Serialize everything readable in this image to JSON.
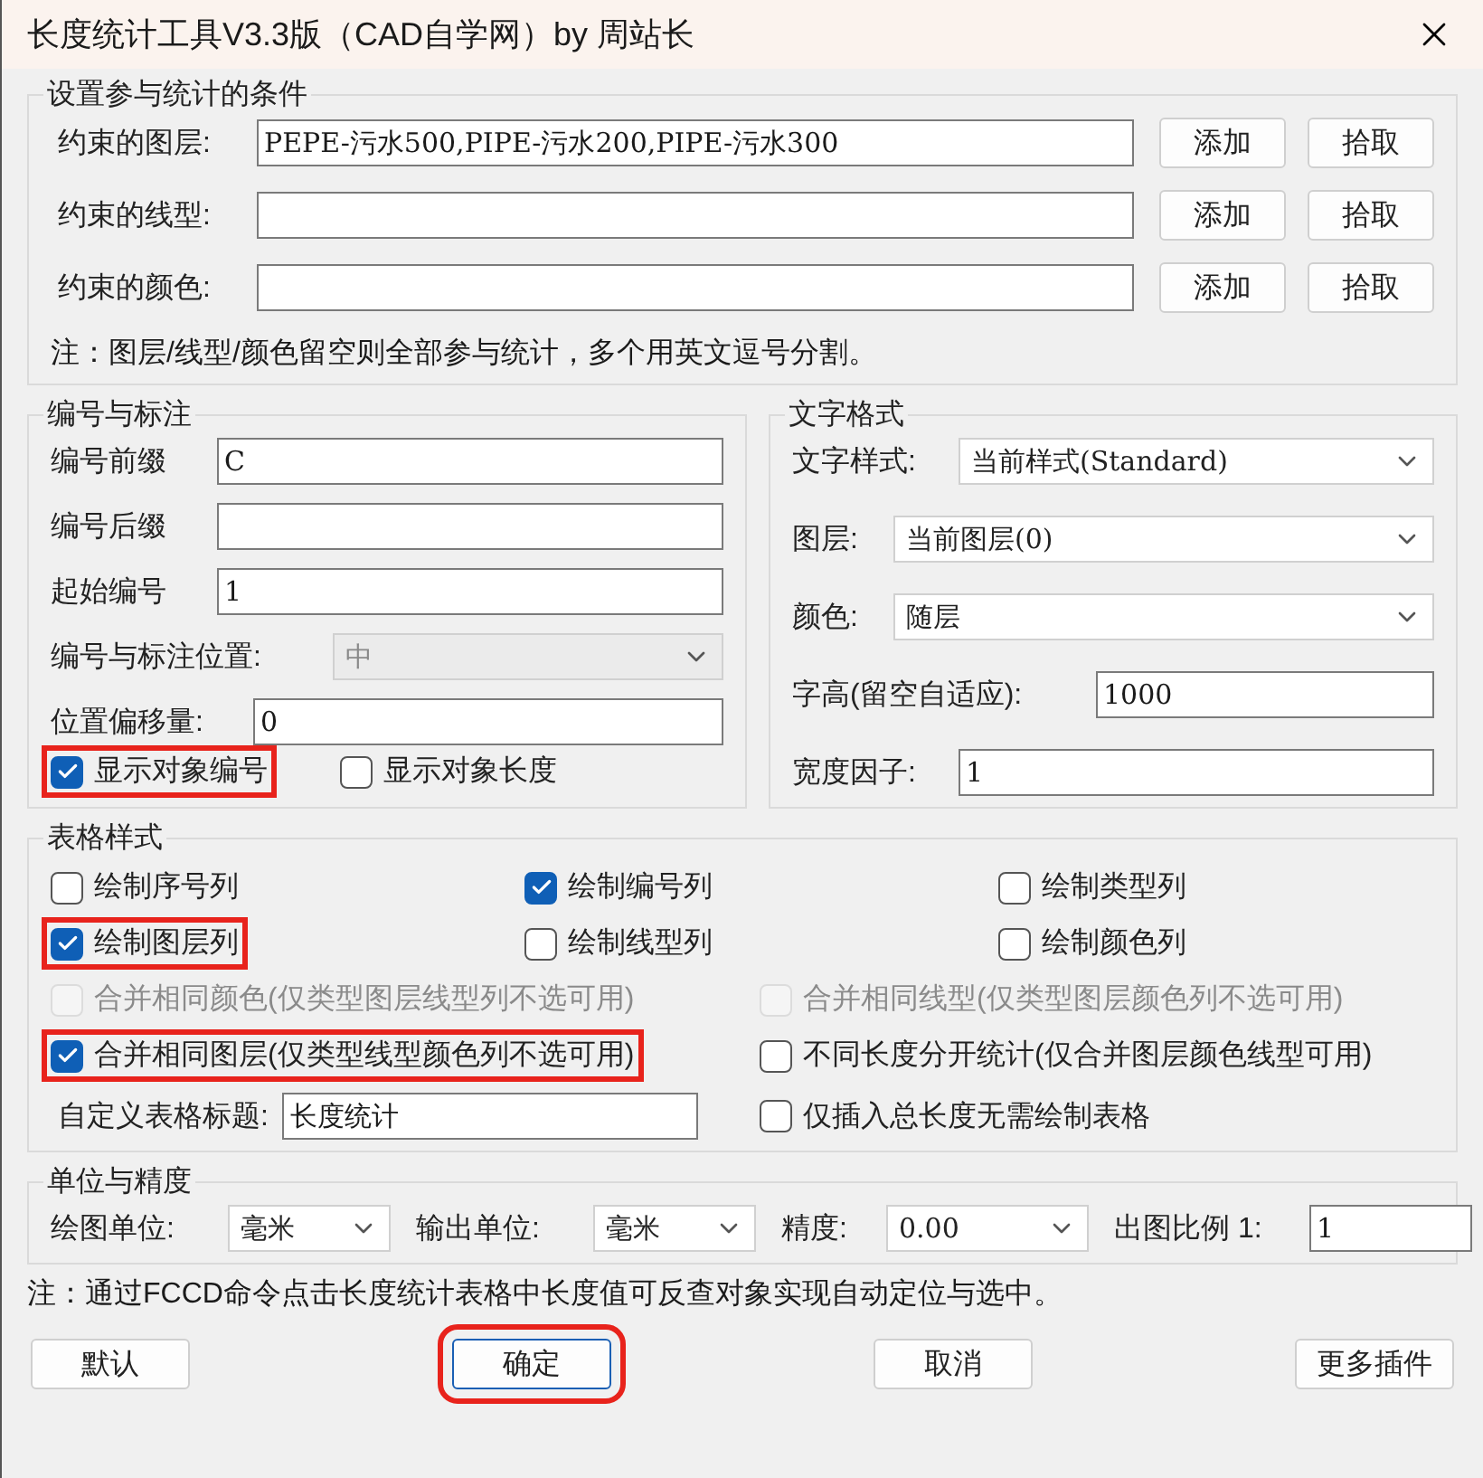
{
  "window": {
    "title": "长度统计工具V3.3版（CAD自学网）by 周站长"
  },
  "conditions": {
    "title": "设置参与统计的条件",
    "rows": [
      {
        "label": "约束的图层:",
        "value": "PEPE-污水500,PIPE-污水200,PIPE-污水300",
        "add": "添加",
        "pick": "拾取"
      },
      {
        "label": "约束的线型:",
        "add": "添加",
        "pick": "拾取"
      },
      {
        "label": "约束的颜色:",
        "add": "添加",
        "pick": "拾取"
      }
    ],
    "note": "注：图层/线型/颜色留空则全部参与统计，多个用英文逗号分割。"
  },
  "numbering": {
    "title": "编号与标注",
    "fields": [
      {
        "kind": "input",
        "label": "编号前缀",
        "value": "C"
      },
      {
        "kind": "input",
        "label": "编号后缀"
      },
      {
        "kind": "input",
        "label": "起始编号",
        "value": "1"
      },
      {
        "kind": "select",
        "label": "编号与标注位置:",
        "value": "中",
        "disabled": true
      },
      {
        "kind": "input",
        "label": "位置偏移量:",
        "value": "0"
      }
    ],
    "checks": [
      {
        "label": "显示对象编号",
        "checked": true,
        "disabled": false,
        "highlighted": true
      },
      {
        "label": "显示对象长度",
        "checked": false,
        "disabled": false,
        "highlighted": false
      }
    ]
  },
  "text_format": {
    "title": "文字格式",
    "fields": [
      {
        "kind": "select",
        "label": "文字样式:",
        "value": "当前样式(Standard)"
      },
      {
        "kind": "select",
        "label": "图层:",
        "value": "当前图层(0)"
      },
      {
        "kind": "select",
        "label": "颜色:",
        "value": "随层"
      },
      {
        "kind": "input",
        "label": "字高(留空自适应):",
        "value": "1000"
      },
      {
        "kind": "input",
        "label": "宽度因子:",
        "value": "1"
      }
    ]
  },
  "table_style": {
    "title": "表格样式",
    "columns": [
      {
        "label": "绘制序号列",
        "checked": false,
        "disabled": false,
        "highlighted": false
      },
      {
        "label": "绘制编号列",
        "checked": true,
        "disabled": false,
        "highlighted": false
      },
      {
        "label": "绘制类型列",
        "checked": false,
        "disabled": false,
        "highlighted": false
      },
      {
        "label": "绘制图层列",
        "checked": true,
        "disabled": false,
        "highlighted": true
      },
      {
        "label": "绘制线型列",
        "checked": false,
        "disabled": false,
        "highlighted": false
      },
      {
        "label": "绘制颜色列",
        "checked": false,
        "disabled": false,
        "highlighted": false
      }
    ],
    "options": [
      {
        "label": "合并相同颜色(仅类型图层线型列不选可用)",
        "checked": false,
        "disabled": true,
        "highlighted": false
      },
      {
        "label": "合并相同线型(仅类型图层颜色列不选可用)",
        "checked": false,
        "disabled": true,
        "highlighted": false
      },
      {
        "label": "合并相同图层(仅类型线型颜色列不选可用)",
        "checked": true,
        "disabled": false,
        "highlighted": true
      },
      {
        "label": "不同长度分开统计(仅合并图层颜色线型可用)",
        "checked": false,
        "disabled": false,
        "highlighted": false
      }
    ],
    "title_field": {
      "label": "自定义表格标题:",
      "value": "长度统计"
    },
    "insert_only": {
      "label": "仅插入总长度无需绘制表格",
      "checked": false,
      "disabled": false,
      "highlighted": false
    }
  },
  "units": {
    "title": "单位与精度",
    "fields": [
      {
        "kind": "select",
        "label": "绘图单位:",
        "value": "毫米"
      },
      {
        "kind": "select",
        "label": "输出单位:",
        "value": "毫米"
      },
      {
        "kind": "select",
        "label": "精度:",
        "value": "0.00"
      },
      {
        "kind": "input",
        "label": "出图比例 1:",
        "value": "1"
      }
    ]
  },
  "note": "注：通过FCCD命令点击长度统计表格中长度值可反查对象实现自动定位与选中。",
  "buttons": [
    {
      "label": "默认",
      "highlighted": false
    },
    {
      "label": "确定",
      "highlighted": true
    },
    {
      "label": "取消",
      "highlighted": false
    },
    {
      "label": "更多插件",
      "highlighted": false
    }
  ]
}
